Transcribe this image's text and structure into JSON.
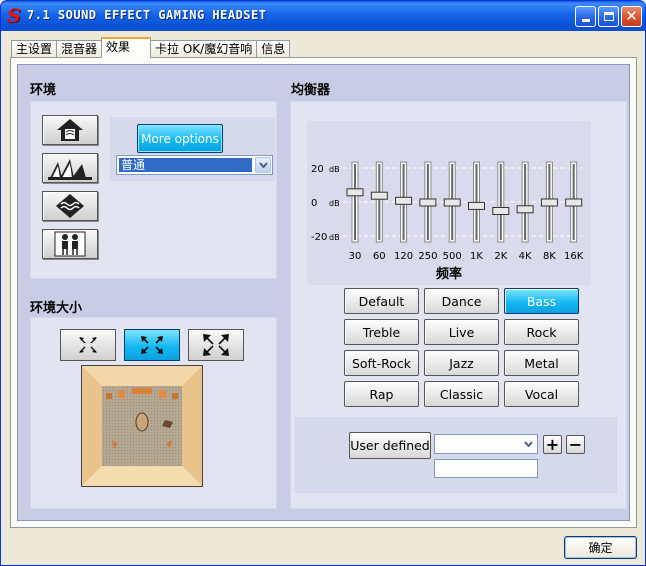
{
  "window": {
    "title": "7.1 SOUND EFFECT GAMING HEADSET",
    "logo": "S",
    "minimize_icon": "minimize-icon",
    "maximize_icon": "maximize-icon",
    "close_icon": "close-icon",
    "close_glyph": "✕"
  },
  "tabs": [
    {
      "label": "主设置",
      "active": false
    },
    {
      "label": "混音器",
      "active": false
    },
    {
      "label": "效果",
      "active": true
    },
    {
      "label": "卡拉 OK/魔幻音响",
      "active": false
    },
    {
      "label": "信息",
      "active": false
    }
  ],
  "environment": {
    "title": "环境",
    "icons": [
      "house-icon",
      "opera-house-icon",
      "underwater-icon",
      "figures-icon"
    ],
    "more_options_label": "More options",
    "selected_environment": "普通"
  },
  "environment_size": {
    "title": "环境大小",
    "options": [
      "small-room-icon",
      "medium-room-icon",
      "large-room-icon"
    ],
    "selected_index": 1
  },
  "equalizer": {
    "title": "均衡器",
    "db_labels": {
      "top": "20",
      "mid": "0",
      "bottom": "-20",
      "unit": "dB"
    },
    "frequency_label": "频率",
    "bands": [
      {
        "freq": "30",
        "gain": 6
      },
      {
        "freq": "60",
        "gain": 4
      },
      {
        "freq": "120",
        "gain": 1
      },
      {
        "freq": "250",
        "gain": 0
      },
      {
        "freq": "500",
        "gain": 0
      },
      {
        "freq": "1K",
        "gain": -2
      },
      {
        "freq": "2K",
        "gain": -5
      },
      {
        "freq": "4K",
        "gain": -4
      },
      {
        "freq": "8K",
        "gain": 0
      },
      {
        "freq": "16K",
        "gain": 0
      }
    ],
    "range": [
      -20,
      20
    ],
    "presets": [
      "Default",
      "Dance",
      "Bass",
      "Treble",
      "Live",
      "Rock",
      "Soft-Rock",
      "Jazz",
      "Metal",
      "Rap",
      "Classic",
      "Vocal"
    ],
    "active_preset": "Bass",
    "user_defined_label": "User defined",
    "user_defined_value": "",
    "preset_name_value": "",
    "add_label": "+",
    "remove_label": "−"
  },
  "footer": {
    "ok_label": "确定"
  },
  "colors": {
    "titlebar": "#0b53d6",
    "panel_bg": "#c8cce4",
    "accent_blue": "#16b8f2",
    "selection": "#316ac5"
  }
}
